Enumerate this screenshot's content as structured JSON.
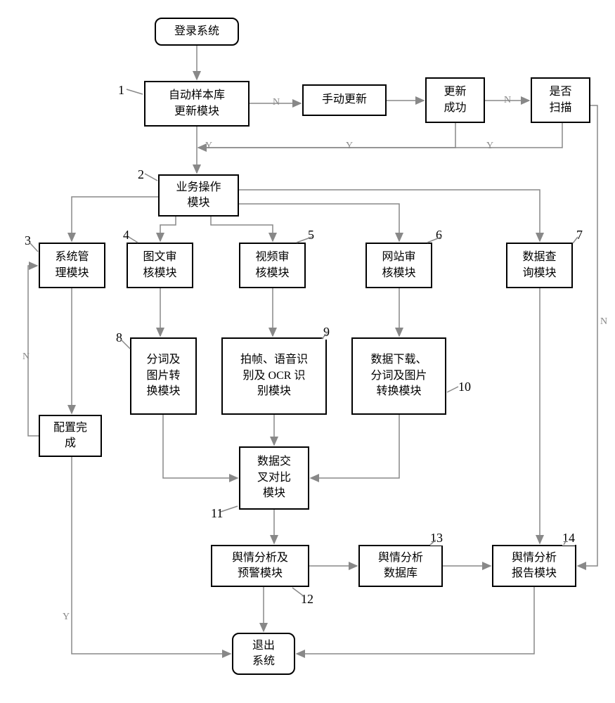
{
  "chart_data": {
    "type": "flowchart",
    "nodes": [
      {
        "id": "login",
        "label": "登录系统",
        "shape": "rounded"
      },
      {
        "id": "n1",
        "label": "自动样本库\n更新模块",
        "shape": "rect",
        "num": "1"
      },
      {
        "id": "manual",
        "label": "手动更新",
        "shape": "rect"
      },
      {
        "id": "upd_ok",
        "label": "更新\n成功",
        "shape": "rect"
      },
      {
        "id": "scan_q",
        "label": "是否\n扫描",
        "shape": "rect"
      },
      {
        "id": "n2",
        "label": "业务操作\n模块",
        "shape": "rect",
        "num": "2"
      },
      {
        "id": "n3",
        "label": "系统管\n理模块",
        "shape": "rect",
        "num": "3"
      },
      {
        "id": "n4",
        "label": "图文审\n核模块",
        "shape": "rect",
        "num": "4"
      },
      {
        "id": "n5",
        "label": "视频审\n核模块",
        "shape": "rect",
        "num": "5"
      },
      {
        "id": "n6",
        "label": "网站审\n核模块",
        "shape": "rect",
        "num": "6"
      },
      {
        "id": "n7",
        "label": "数据查\n询模块",
        "shape": "rect",
        "num": "7"
      },
      {
        "id": "n8",
        "label": "分词及\n图片转\n换模块",
        "shape": "rect",
        "num": "8"
      },
      {
        "id": "n9",
        "label": "拍帧、语音识\n别及 OCR 识\n别模块",
        "shape": "rect",
        "num": "9"
      },
      {
        "id": "n10",
        "label": "数据下载、\n分词及图片\n转换模块",
        "shape": "rect",
        "num": "10"
      },
      {
        "id": "cfg",
        "label": "配置完\n成",
        "shape": "rect"
      },
      {
        "id": "n11",
        "label": "数据交\n叉对比\n模块",
        "shape": "rect",
        "num": "11"
      },
      {
        "id": "n12",
        "label": "舆情分析及\n预警模块",
        "shape": "rect",
        "num": "12"
      },
      {
        "id": "n13",
        "label": "舆情分析\n数据库",
        "shape": "rect",
        "num": "13"
      },
      {
        "id": "n14",
        "label": "舆情分析\n报告模块",
        "shape": "rect",
        "num": "14"
      },
      {
        "id": "exit",
        "label": "退出\n系统",
        "shape": "rounded"
      }
    ],
    "edges": [
      {
        "from": "login",
        "to": "n1"
      },
      {
        "from": "n1",
        "to": "manual",
        "label": "N"
      },
      {
        "from": "manual",
        "to": "upd_ok"
      },
      {
        "from": "upd_ok",
        "to": "scan_q",
        "label": "N"
      },
      {
        "from": "n1",
        "to": "n2",
        "label": "Y"
      },
      {
        "from": "upd_ok",
        "to": "n2",
        "label": "Y"
      },
      {
        "from": "scan_q",
        "to": "n2",
        "label": "Y"
      },
      {
        "from": "scan_q",
        "to": "n14",
        "label": "N"
      },
      {
        "from": "n2",
        "to": "n3"
      },
      {
        "from": "n2",
        "to": "n4"
      },
      {
        "from": "n2",
        "to": "n5"
      },
      {
        "from": "n2",
        "to": "n6"
      },
      {
        "from": "n2",
        "to": "n7"
      },
      {
        "from": "n3",
        "to": "cfg"
      },
      {
        "from": "cfg",
        "to": "n3",
        "label": "N"
      },
      {
        "from": "cfg",
        "to": "exit",
        "label": "Y"
      },
      {
        "from": "n4",
        "to": "n8"
      },
      {
        "from": "n5",
        "to": "n9"
      },
      {
        "from": "n6",
        "to": "n10"
      },
      {
        "from": "n8",
        "to": "n11"
      },
      {
        "from": "n9",
        "to": "n11"
      },
      {
        "from": "n10",
        "to": "n11"
      },
      {
        "from": "n11",
        "to": "n12"
      },
      {
        "from": "n12",
        "to": "n13"
      },
      {
        "from": "n12",
        "to": "exit"
      },
      {
        "from": "n13",
        "to": "n14"
      },
      {
        "from": "n7",
        "to": "n14"
      },
      {
        "from": "n14",
        "to": "exit"
      }
    ]
  },
  "labels": {
    "login": "登录系统",
    "n1": "自动样本库\n更新模块",
    "manual": "手动更新",
    "upd_ok": "更新\n成功",
    "scan_q": "是否\n扫描",
    "n2": "业务操作\n模块",
    "n3": "系统管\n理模块",
    "n4": "图文审\n核模块",
    "n5": "视频审\n核模块",
    "n6": "网站审\n核模块",
    "n7": "数据查\n询模块",
    "n8": "分词及\n图片转\n换模块",
    "n9": "拍帧、语音识\n别及 OCR 识\n别模块",
    "n10": "数据下载、\n分词及图片\n转换模块",
    "cfg": "配置完\n成",
    "n11": "数据交\n叉对比\n模块",
    "n12": "舆情分析及\n预警模块",
    "n13": "舆情分析\n数据库",
    "n14": "舆情分析\n报告模块",
    "exit": "退出\n系统"
  },
  "nums": {
    "n1": "1",
    "n2": "2",
    "n3": "3",
    "n4": "4",
    "n5": "5",
    "n6": "6",
    "n7": "7",
    "n8": "8",
    "n9": "9",
    "n10": "10",
    "n11": "11",
    "n12": "12",
    "n13": "13",
    "n14": "14"
  },
  "edge_text": {
    "Y": "Y",
    "N": "N"
  }
}
